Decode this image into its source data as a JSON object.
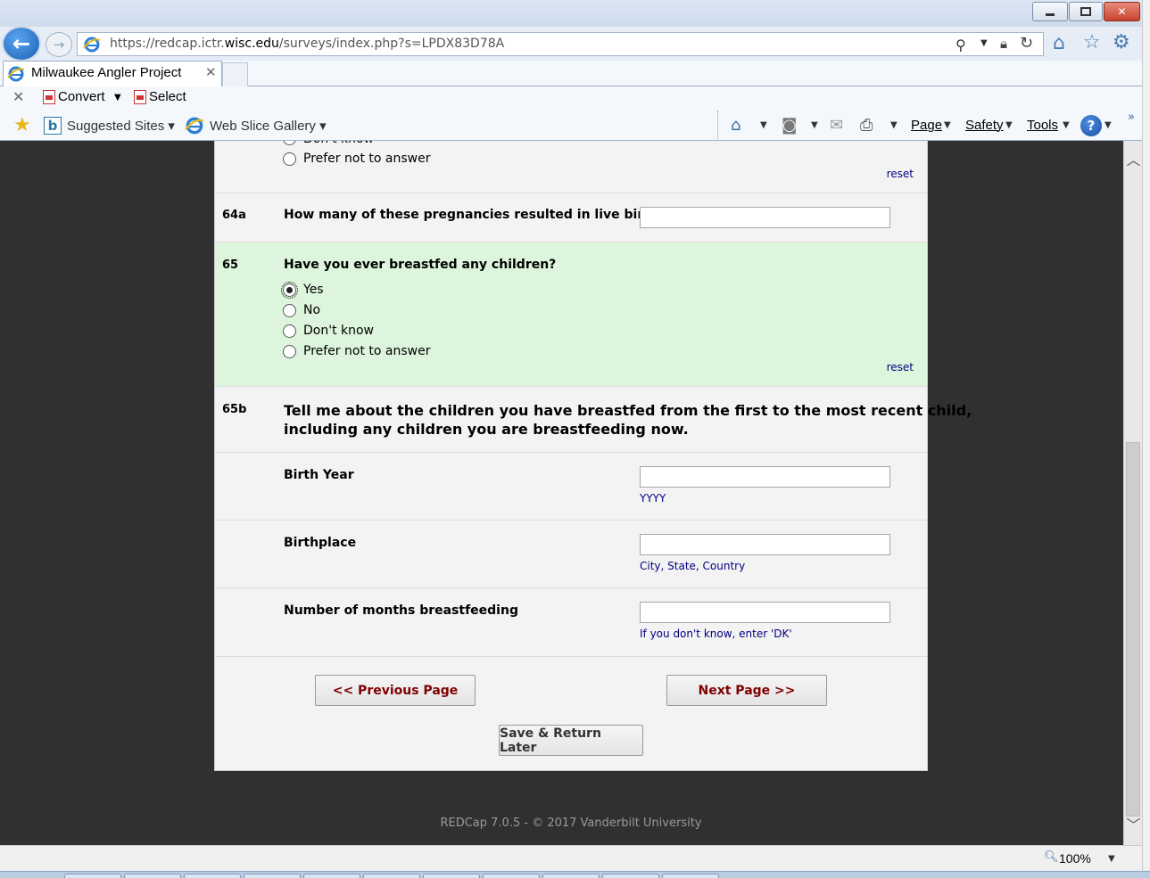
{
  "browser": {
    "url_prefix": "https://redcap.ictr.",
    "url_domain": "wisc.edu",
    "url_suffix": "/surveys/index.php?s=LPDX83D78A",
    "tab_title": "Milwaukee Angler Project",
    "command_bar": {
      "convert_label": "Convert",
      "select_label": "Select"
    },
    "favorites": {
      "suggested_label": "Suggested Sites ▾",
      "webslice_label": "Web Slice Gallery ▾"
    },
    "toolbar": {
      "page_label": "Page",
      "safety_label": "Safety",
      "tools_label": "Tools"
    },
    "zoom": "100%"
  },
  "survey": {
    "prev_question": {
      "last_option_label": "Prefer not to answer",
      "reset_label": "reset"
    },
    "q64a": {
      "number": "64a",
      "text": "How many of these pregnancies resulted in live birth?",
      "value": ""
    },
    "q65": {
      "number": "65",
      "text": "Have you ever breastfed any children?",
      "options": [
        "Yes",
        "No",
        "Don't know",
        "Prefer not to answer"
      ],
      "selected": "Yes",
      "reset_label": "reset"
    },
    "q65b": {
      "number": "65b",
      "text_line1": "Tell me about the children you have breastfed from the first to the most recent child,",
      "text_line2": "including any children you are breastfeeding now."
    },
    "fields": {
      "birth_year": {
        "label": "Birth Year",
        "note": "YYYY",
        "value": ""
      },
      "birthplace": {
        "label": "Birthplace",
        "note": "City, State, Country",
        "value": ""
      },
      "months": {
        "label": "Number of months breastfeeding",
        "note": "If you don't know, enter 'DK'",
        "value": ""
      }
    },
    "buttons": {
      "previous": "<< Previous Page",
      "next": "Next Page >>",
      "save": "Save & Return Later"
    },
    "footer": "REDCap 7.0.5 - © 2017 Vanderbilt University"
  },
  "colors": {
    "selected_row_bg": "#dcf5dc",
    "button_text": "#800000",
    "note_text": "#000080"
  }
}
